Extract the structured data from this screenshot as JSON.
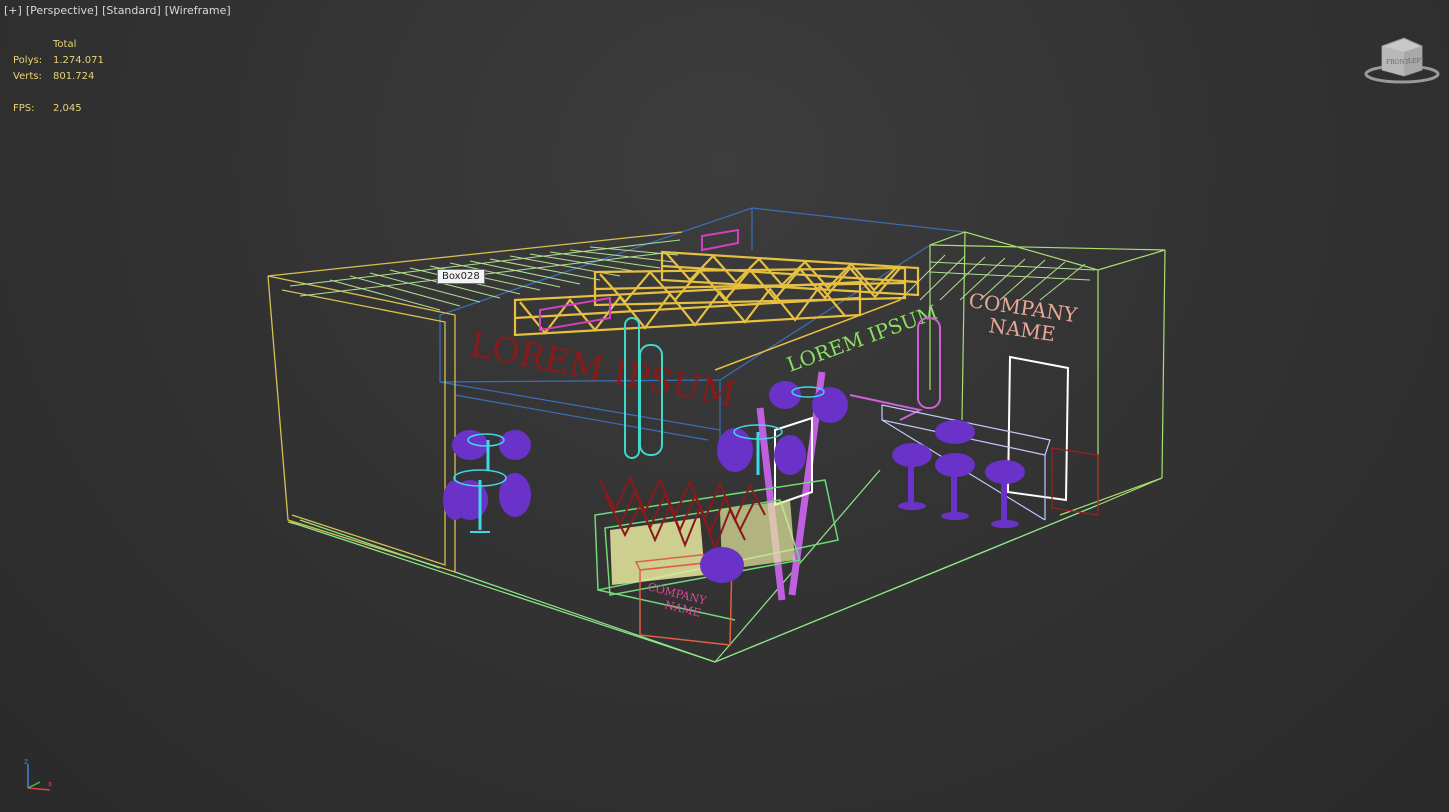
{
  "viewport": {
    "labels": [
      "[+]",
      "[Perspective]",
      "[Standard]",
      "[Wireframe]"
    ]
  },
  "stats": {
    "header": "Total",
    "polys_label": "Polys:",
    "polys_value": "1.274.071",
    "verts_label": "Verts:",
    "verts_value": "801.724",
    "fps_label": "FPS:",
    "fps_value": "2,045"
  },
  "selection_tooltip": "Box028",
  "scene": {
    "sign_lorem": "LOREM IPSUM",
    "sign_lorem_small": "LOREM IPSUM",
    "company_line1": "COMPANY",
    "company_line2": "NAME",
    "counter_line1": "COMPANY",
    "counter_line2": "NAME"
  },
  "viewcube": {
    "face_label": "FRONT",
    "side_label": "LEFT"
  },
  "axis": {
    "z_label": "z",
    "x_label": "x"
  },
  "colors": {
    "background": "#333333",
    "stats_text": "#e8d27a",
    "truss": "#e8c040",
    "wall_yellow": "#d8c050",
    "wall_green": "#a8e070",
    "wall_blue": "#3a6fb8",
    "furniture_purple": "#6a32c8",
    "lorem_red": "#8a1a1a",
    "company_text": "#e8a898",
    "pink": "#d060d8"
  }
}
